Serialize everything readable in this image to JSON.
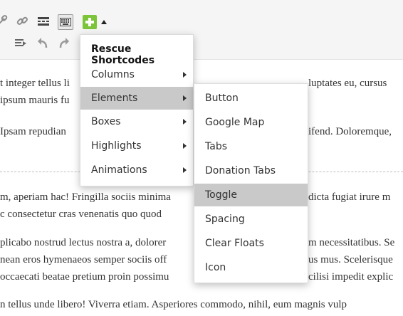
{
  "toolbar": {
    "icons": [
      "link-icon",
      "unlink-icon",
      "more-tag-icon",
      "toolbar-toggle-icon",
      "add-shortcode-icon",
      "dropdown-caret-icon",
      "paste-text-icon",
      "undo-icon",
      "redo-icon"
    ]
  },
  "content": {
    "lines": [
      "t integer tellus li",
      "ipsum mauris fu",
      "Ipsam repudian",
      "m, aperiam hac! Fringilla sociis minima",
      "c consectetur cras venenatis quo quod",
      "plicabo nostrud lectus nostra a, dolorer",
      "nean eros hymenaeos semper sociis off",
      "occaecati beatae pretium proin possimu",
      "n tellus unde libero! Viverra etiam. Asperiores commodo, nihil, eum magnis vulp"
    ],
    "right_fragments": [
      "luptates eu, cursus",
      "ifend. Doloremque,",
      "dicta fugiat irure m",
      "m necessitatibus. Se",
      "us mus. Scelerisque",
      "cilisi impedit explic"
    ]
  },
  "menu": {
    "title": "Rescue Shortcodes",
    "items": [
      "Columns",
      "Elements",
      "Boxes",
      "Highlights",
      "Animations"
    ],
    "selected": "Elements"
  },
  "submenu": {
    "items": [
      "Button",
      "Google Map",
      "Tabs",
      "Donation Tabs",
      "Toggle",
      "Spacing",
      "Clear Floats",
      "Icon"
    ],
    "selected": "Toggle"
  },
  "colors": {
    "accent_green": "#7cc43a",
    "selected_bg": "#c9c9c9"
  }
}
